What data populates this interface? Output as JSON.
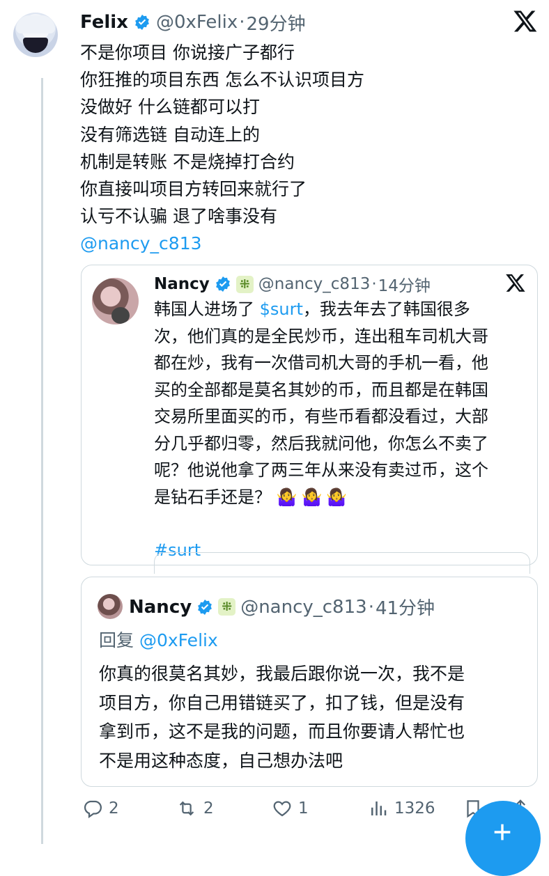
{
  "tweet": {
    "name": "Felix",
    "handle": "@0xFelix",
    "time": "29分钟",
    "separator": "·",
    "lines": [
      "不是你项目 你说接广子都行",
      "你狂推的项目东西 怎么不认识项目方",
      "没做好 什么链都可以打",
      "没有筛选链 自动连上的",
      "机制是转账 不是烧掉打合约",
      "你直接叫项目方转回来就行了",
      "认亏不认骗 退了啥事没有"
    ],
    "mention": "@nancy_c813"
  },
  "quote1": {
    "name": "Nancy",
    "badge": "⁜",
    "handle": "@nancy_c813",
    "time": "14分钟",
    "separator": "·",
    "line1_pre": "韩国人进场了 ",
    "line1_cashtag": "$surt",
    "line1_post": "，我去年去了韩国很多",
    "lines": [
      "次，他们真的是全民炒币，连出租车司机大哥",
      "都在炒，我有一次借司机大哥的手机一看，他",
      "买的全部都是莫名其妙的币，而且都是在韩国",
      "交易所里面买的币，有些币看都没看过，大部",
      "分几乎都归零，然后我就问他，你怎么不卖了",
      "呢？他说他拿了两三年从来没有卖过币，这个"
    ],
    "last_line": "是钻石手还是？",
    "emoji": "🤷‍♀️🤷‍♀️🤷‍♀️",
    "hashtag": "#surt"
  },
  "quote2": {
    "name": "Nancy",
    "badge": "⁜",
    "handle": "@nancy_c813",
    "time": "41分钟",
    "separator": "·",
    "reply_label": "回复",
    "reply_handle": "@0xFelix",
    "lines": [
      "你真的很莫名其妙，我最后跟你说一次，我不是",
      "项目方，你自己用错链买了，扣了钱，但是没有",
      "拿到币，这不是我的问题，而且你要请人帮忙也",
      "不是用这种态度，自己想办法吧"
    ]
  },
  "actions": {
    "replies": "2",
    "retweets": "2",
    "likes": "1",
    "views": "1326"
  },
  "colors": {
    "link": "#1d9bf0",
    "muted": "#536471",
    "border": "#cfd9de"
  }
}
